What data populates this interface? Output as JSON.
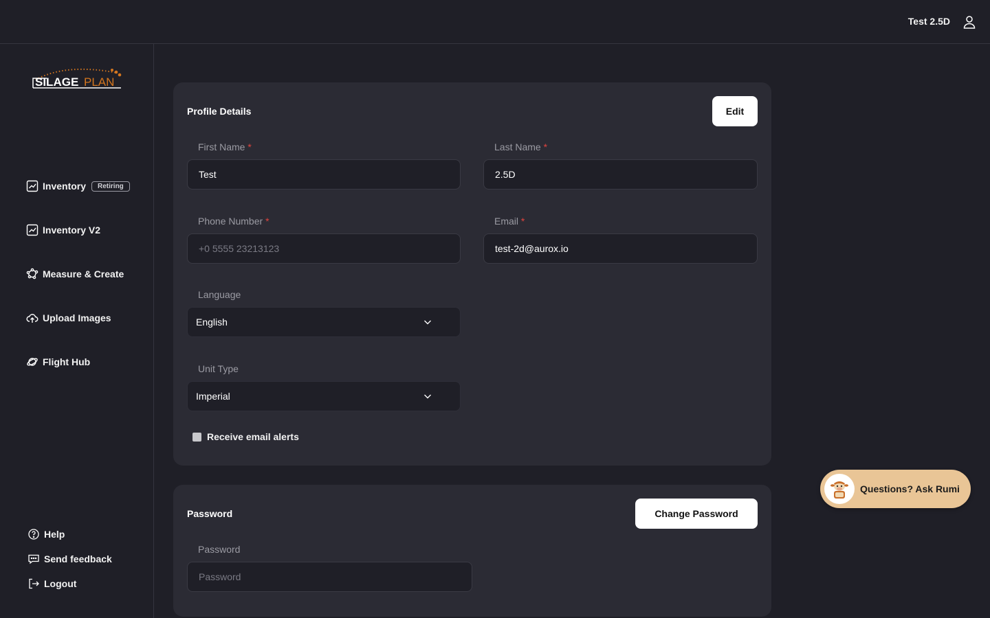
{
  "header": {
    "user_name": "Test 2.5D",
    "user_icon": "user-icon"
  },
  "brand": {
    "logo_text_1": "SILAGE",
    "logo_text_2": "PLAN",
    "accent_color": "#d4761f"
  },
  "sidebar": {
    "items": [
      {
        "label": "Inventory",
        "badge": "Retiring",
        "icon": "chart-icon"
      },
      {
        "label": "Inventory V2",
        "icon": "chart-icon"
      },
      {
        "label": "Measure & Create",
        "icon": "polygon-icon"
      },
      {
        "label": "Upload Images",
        "icon": "cloud-upload-icon"
      },
      {
        "label": "Flight Hub",
        "icon": "planet-icon"
      }
    ],
    "footer": [
      {
        "label": "Help",
        "icon": "help-icon"
      },
      {
        "label": "Send feedback",
        "icon": "chat-icon"
      },
      {
        "label": "Logout",
        "icon": "logout-icon"
      }
    ]
  },
  "profile": {
    "title": "Profile Details",
    "edit_label": "Edit",
    "first_name": {
      "label": "First Name",
      "required": "*",
      "value": "Test"
    },
    "last_name": {
      "label": "Last Name",
      "required": "*",
      "value": "2.5D"
    },
    "phone": {
      "label": "Phone Number",
      "required": "*",
      "placeholder": "+0 5555 23213123"
    },
    "email": {
      "label": "Email",
      "required": "*",
      "value": "test-2d@aurox.io"
    },
    "language": {
      "label": "Language",
      "value": "English"
    },
    "unit_type": {
      "label": "Unit Type",
      "value": "Imperial"
    },
    "email_alerts": {
      "label": "Receive email alerts",
      "checked": false
    }
  },
  "password": {
    "title": "Password",
    "change_label": "Change Password",
    "field_label": "Password",
    "placeholder": "Password"
  },
  "rumi": {
    "label": "Questions? Ask Rumi",
    "color": "#e9c596"
  }
}
